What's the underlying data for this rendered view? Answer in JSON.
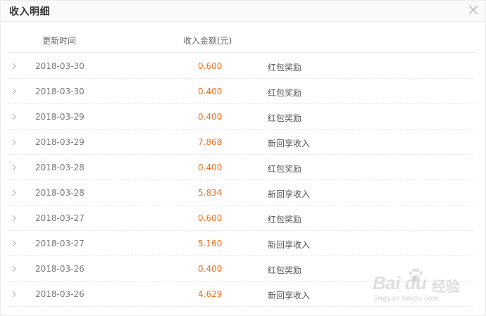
{
  "dialog": {
    "title": "收入明细",
    "close_icon": "close-icon"
  },
  "table": {
    "headers": {
      "time": "更新时间",
      "amount": "收入金额(元)"
    },
    "rows": [
      {
        "date": "2018-03-30",
        "amount": "0.600",
        "type": "红包奖励"
      },
      {
        "date": "2018-03-30",
        "amount": "0.400",
        "type": "红包奖励"
      },
      {
        "date": "2018-03-29",
        "amount": "0.400",
        "type": "红包奖励"
      },
      {
        "date": "2018-03-29",
        "amount": "7.868",
        "type": "新回享收入"
      },
      {
        "date": "2018-03-28",
        "amount": "0.400",
        "type": "红包奖励"
      },
      {
        "date": "2018-03-28",
        "amount": "5.834",
        "type": "新回享收入"
      },
      {
        "date": "2018-03-27",
        "amount": "0.600",
        "type": "红包奖励"
      },
      {
        "date": "2018-03-27",
        "amount": "5.160",
        "type": "新回享收入"
      },
      {
        "date": "2018-03-26",
        "amount": "0.400",
        "type": "红包奖励"
      },
      {
        "date": "2018-03-26",
        "amount": "4.629",
        "type": "新回享收入"
      }
    ]
  },
  "watermark": {
    "brand": "Bai du",
    "cn": "经验",
    "url": "jingyan.baidu.com"
  },
  "colors": {
    "amount": "#f26d1e",
    "title": "#333333"
  }
}
